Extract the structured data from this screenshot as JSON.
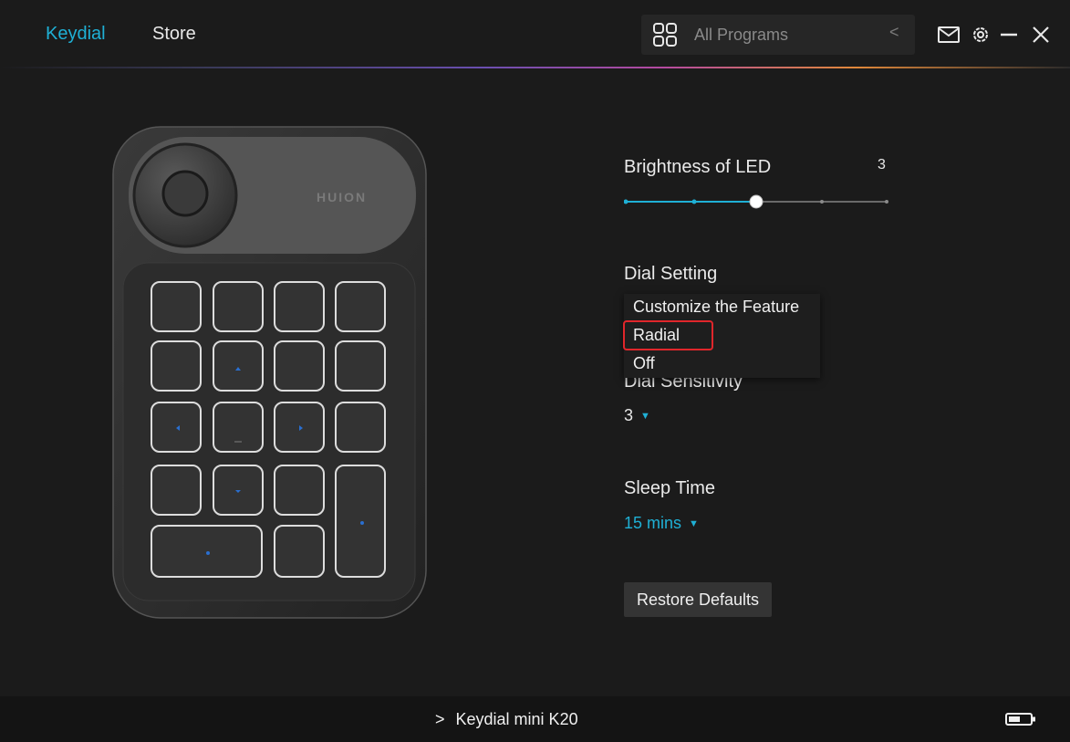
{
  "nav": {
    "tabs": [
      {
        "label": "Keydial",
        "active": true
      },
      {
        "label": "Store",
        "active": false
      }
    ]
  },
  "program_selector": {
    "icon": "grid-icon",
    "value": "All Programs",
    "chevron": "<"
  },
  "window_controls": {
    "icons": [
      "mail-icon",
      "gear-icon",
      "minimize-icon",
      "close-icon"
    ]
  },
  "device_image": {
    "brand": "HUION"
  },
  "settings": {
    "brightness": {
      "title": "Brightness of LED",
      "value": "3",
      "level": 3,
      "max_level": 5
    },
    "dial_setting": {
      "title": "Dial Setting",
      "options": [
        "Customize the Feature",
        "Radial",
        "Off"
      ],
      "highlighted": "Radial"
    },
    "dial_sensitivity": {
      "title": "Dial Sensitivity",
      "value": "3"
    },
    "sleep_time": {
      "title": "Sleep Time",
      "value": "15 mins"
    },
    "restore_label": "Restore Defaults"
  },
  "footer": {
    "device_name": "Keydial mini K20",
    "chevron": ">",
    "battery_icon": "battery-icon"
  },
  "colors": {
    "accent": "#1fb0d5",
    "highlight_border": "#e0262b",
    "background": "#1b1b1b"
  }
}
